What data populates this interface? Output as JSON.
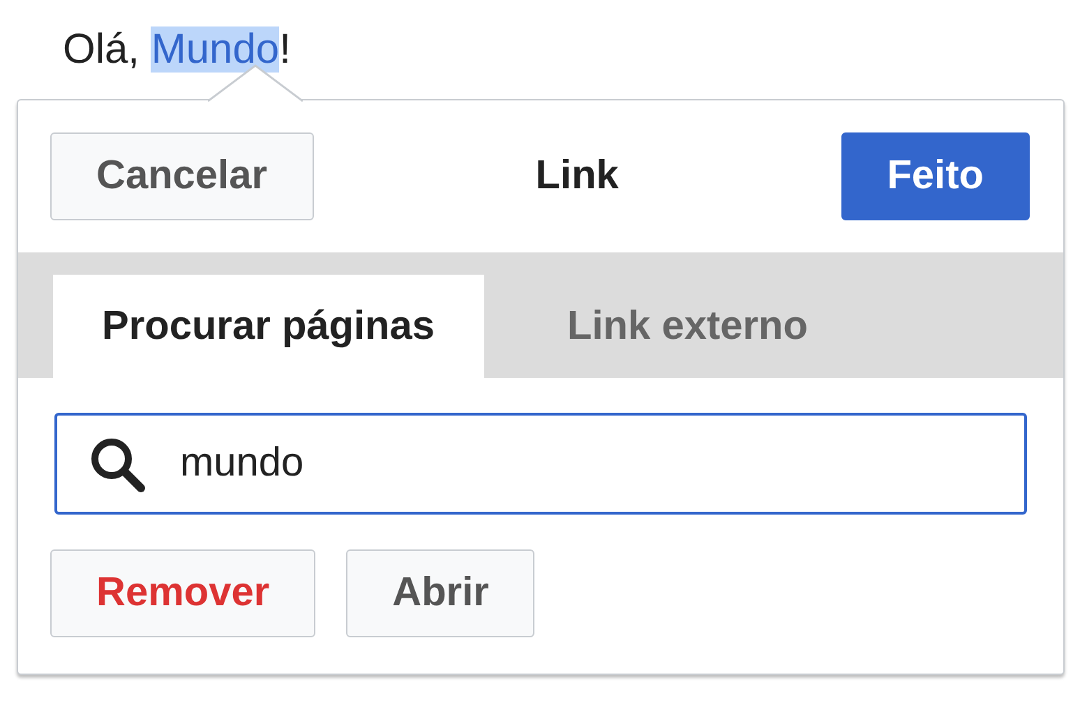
{
  "text": {
    "before": "Olá, ",
    "selected": "Mundo",
    "after": "!"
  },
  "dialog": {
    "cancel": "Cancelar",
    "title": "Link",
    "done": "Feito"
  },
  "tabs": [
    {
      "label": "Procurar páginas",
      "selected": true
    },
    {
      "label": "Link externo",
      "selected": false
    }
  ],
  "search": {
    "value": "mundo"
  },
  "actions": [
    {
      "label": "Remover",
      "kind": "destructive"
    },
    {
      "label": "Abrir",
      "kind": "normal"
    }
  ]
}
